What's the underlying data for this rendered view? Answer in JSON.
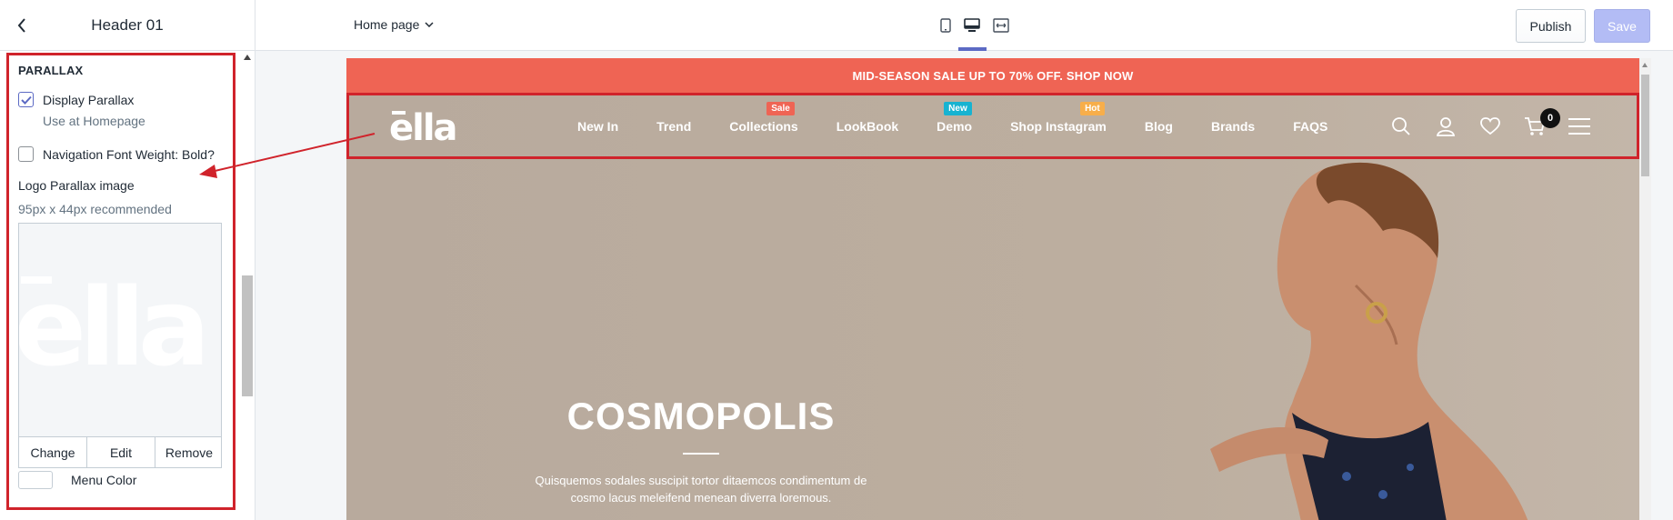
{
  "sidebar": {
    "title": "Header 01",
    "section_title": "PARALLAX",
    "display_parallax_label": "Display Parallax",
    "display_parallax_checked": true,
    "display_parallax_hint": "Use at Homepage",
    "nav_font_bold_label": "Navigation Font Weight: Bold?",
    "nav_font_bold_checked": false,
    "logo_label": "Logo Parallax image",
    "logo_hint": "95px x 44px recommended",
    "logo_text": "ella",
    "image_buttons": [
      "Change",
      "Edit",
      "Remove"
    ],
    "menu_color_label": "Menu Color"
  },
  "topbar": {
    "page_select": "Home page",
    "devices": [
      "mobile-icon",
      "desktop-icon",
      "fullscreen-icon"
    ],
    "active_device": "desktop-icon",
    "publish_label": "Publish",
    "save_label": "Save"
  },
  "preview": {
    "announcement": "MID-SEASON SALE UP TO 70% OFF. SHOP NOW",
    "logo": "ella",
    "nav": [
      {
        "label": "New In",
        "badge": ""
      },
      {
        "label": "Trend",
        "badge": ""
      },
      {
        "label": "Collections",
        "badge": "Sale"
      },
      {
        "label": "LookBook",
        "badge": ""
      },
      {
        "label": "Demo",
        "badge": "New"
      },
      {
        "label": "Shop Instagram",
        "badge": "Hot"
      },
      {
        "label": "Blog",
        "badge": ""
      },
      {
        "label": "Brands",
        "badge": ""
      },
      {
        "label": "FAQS",
        "badge": ""
      }
    ],
    "cart_count": "0",
    "hero_title": "COSMOPOLIS",
    "hero_text_1": "Quisquemos sodales suscipit tortor ditaemcos condimentum de",
    "hero_text_2": "cosmo lacus meleifend menean diverra loremous."
  },
  "colors": {
    "accent": "#5c6ac4",
    "announcement_bg": "#ef6454",
    "highlight_border": "#d0232b",
    "badge_sale": "#ef6454",
    "badge_new": "#17b3d1",
    "badge_hot": "#f7ae4a",
    "hero_bg": "#bcae9f"
  }
}
